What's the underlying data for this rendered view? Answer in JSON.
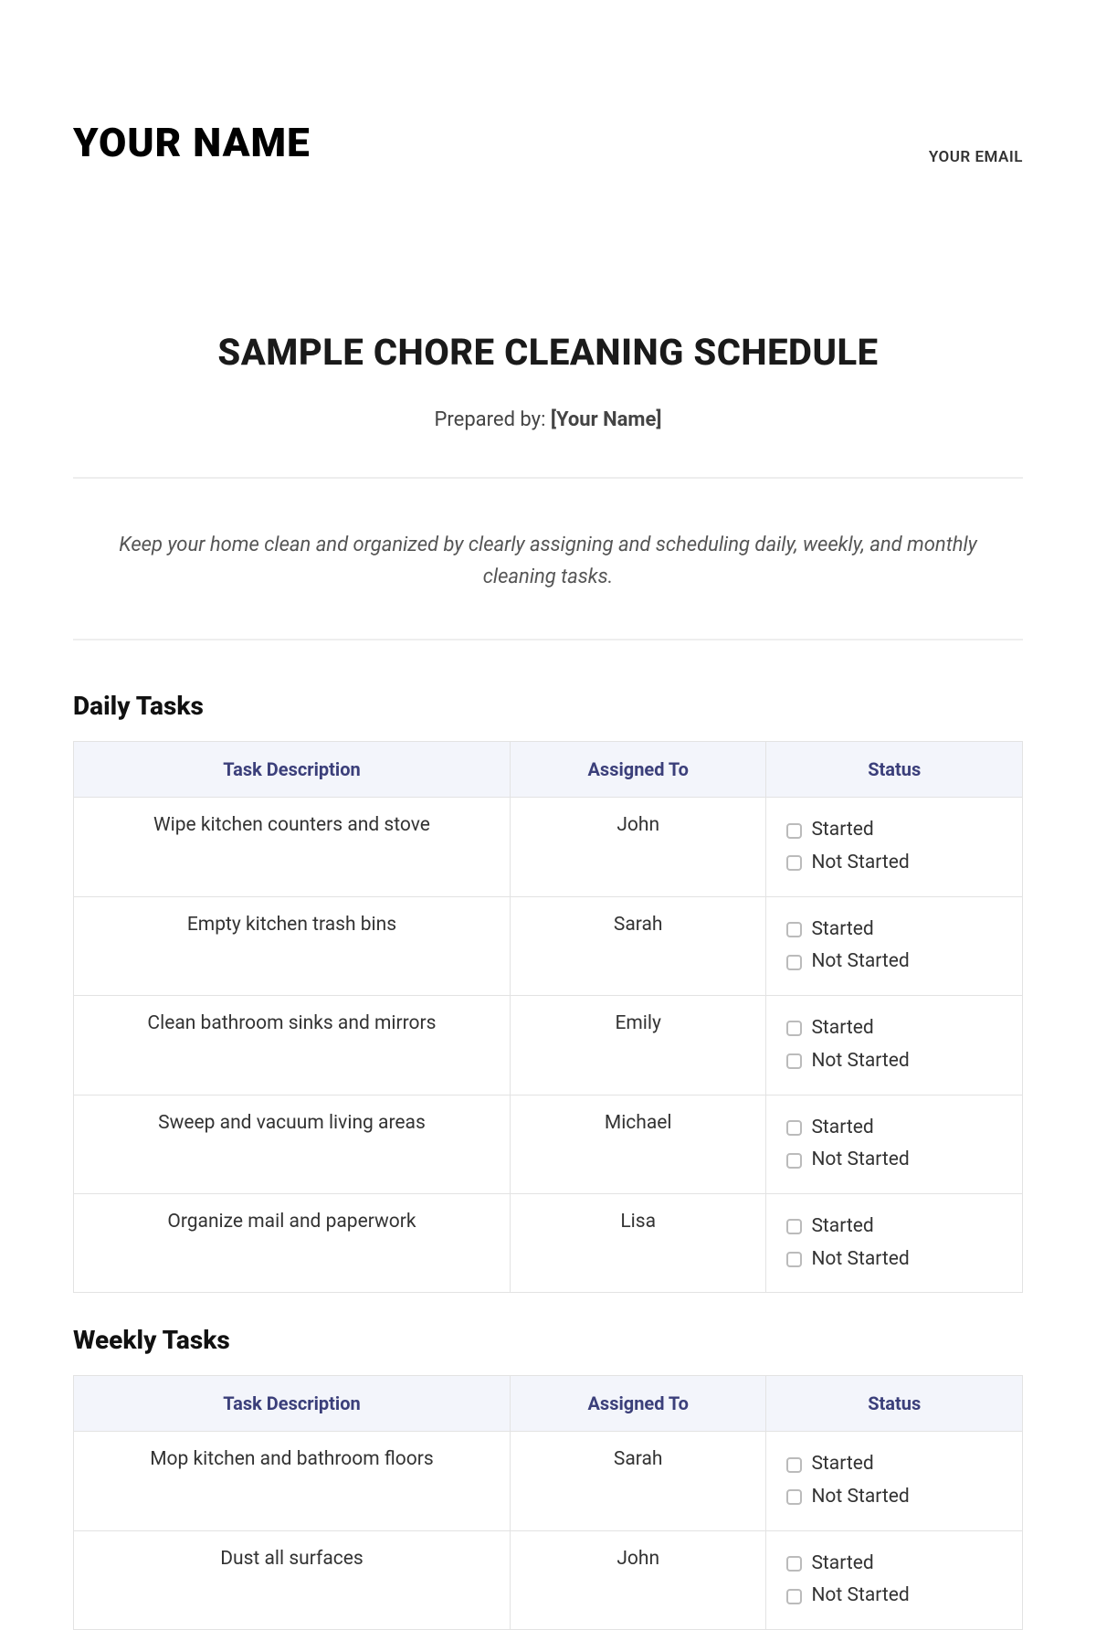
{
  "header": {
    "brand": "YOUR NAME",
    "email": "YOUR EMAIL"
  },
  "title": "SAMPLE CHORE CLEANING SCHEDULE",
  "prepared": {
    "label": "Prepared by: ",
    "value": "[Your Name]"
  },
  "intro": "Keep your home clean and organized by clearly assigning and scheduling daily, weekly, and monthly cleaning tasks.",
  "columns": {
    "task": "Task Description",
    "assigned": "Assigned To",
    "status": "Status"
  },
  "status_options": {
    "started": "Started",
    "not_started": "Not Started"
  },
  "sections": [
    {
      "title": "Daily Tasks",
      "rows": [
        {
          "task": "Wipe kitchen counters and stove",
          "assigned": "John"
        },
        {
          "task": "Empty kitchen trash bins",
          "assigned": "Sarah"
        },
        {
          "task": "Clean bathroom sinks and mirrors",
          "assigned": "Emily"
        },
        {
          "task": "Sweep and vacuum living areas",
          "assigned": "Michael"
        },
        {
          "task": "Organize mail and paperwork",
          "assigned": "Lisa"
        }
      ]
    },
    {
      "title": "Weekly Tasks",
      "rows": [
        {
          "task": "Mop kitchen and bathroom floors",
          "assigned": "Sarah"
        },
        {
          "task": "Dust all surfaces",
          "assigned": "John"
        }
      ]
    }
  ]
}
